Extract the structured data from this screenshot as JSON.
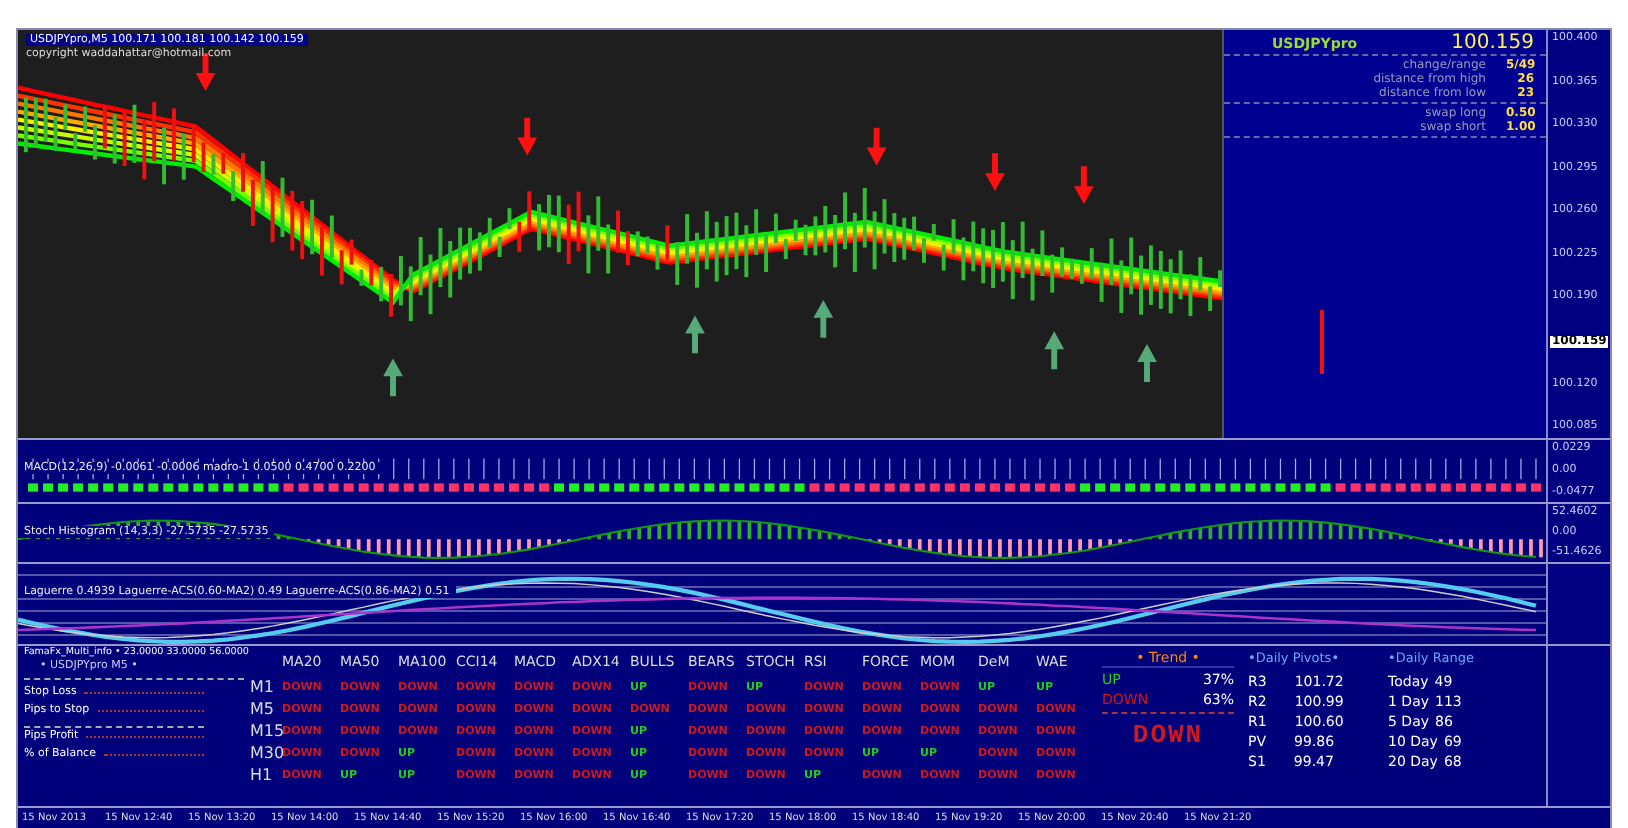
{
  "header": {
    "symbol_line": "USDJPYpro,M5  100.171 100.181 100.142 100.159",
    "copyright": "copyright waddahattar@hotmail.com"
  },
  "info_panel": {
    "symbol": "USDJPYpro",
    "price": "100.159",
    "rows": [
      {
        "label": "change/range",
        "value": "5/49"
      },
      {
        "label": "distance from high",
        "value": "26"
      },
      {
        "label": "distance from low",
        "value": "23"
      }
    ],
    "swap_rows": [
      {
        "label": "swap long",
        "value": "0.50"
      },
      {
        "label": "swap short",
        "value": "1.00"
      }
    ]
  },
  "price_axis": [
    {
      "label": "100.400",
      "current": false
    },
    {
      "label": "100.365",
      "current": false
    },
    {
      "label": "100.330",
      "current": false
    },
    {
      "label": "100.295",
      "current": false
    },
    {
      "label": "100.260",
      "current": false
    },
    {
      "label": "100.225",
      "current": false
    },
    {
      "label": "100.190",
      "current": false
    },
    {
      "label": "100.159",
      "current": true
    },
    {
      "label": "100.120",
      "current": false
    },
    {
      "label": "100.085",
      "current": false
    }
  ],
  "macd": {
    "legend": "MACD(12,26,9) -0.0061 -0.0006  madro-1 0.0500 0.4700 0.2200",
    "axis": [
      "0.0229",
      "0.00",
      "-0.0477"
    ]
  },
  "stoch": {
    "legend": "Stoch Histogram (14,3,3) -27.5735 -27.5735",
    "axis": [
      "52.4602",
      "0.00",
      "-51.4626"
    ]
  },
  "laguerre": {
    "legend": "Laguerre 0.4939  Laguerre-ACS(0.60-MA2) 0.49  Laguerre-ACS(0.86-MA2) 0.51"
  },
  "signals": {
    "header": "FamaFx_Multi_info • 23.0000 33.0000 56.0000",
    "symbol": "• USDJPYpro M5 •",
    "fields": [
      "Stop Loss",
      "Pips to Stop",
      "Pips Profit",
      "% of Balance"
    ],
    "columns": [
      "MA20",
      "MA50",
      "MA100",
      "CCI14",
      "MACD",
      "ADX14",
      "BULLS",
      "BEARS",
      "STOCH",
      "RSI",
      "FORCE",
      "MOM",
      "DeM",
      "WAE"
    ],
    "rows": [
      {
        "timeframe": "M1",
        "cells": [
          {
            "text": "DOWN",
            "kind": "down"
          },
          {
            "text": "DOWN",
            "kind": "down"
          },
          {
            "text": "DOWN",
            "kind": "down"
          },
          {
            "text": "DOWN",
            "kind": "down"
          },
          {
            "text": "DOWN",
            "kind": "down"
          },
          {
            "text": "DOWN",
            "kind": "down"
          },
          {
            "text": "UP",
            "kind": "up"
          },
          {
            "text": "DOWN",
            "kind": "down"
          },
          {
            "text": "UP",
            "kind": "up"
          },
          {
            "text": "DOWN",
            "kind": "down"
          },
          {
            "text": "DOWN",
            "kind": "down"
          },
          {
            "text": "DOWN",
            "kind": "down"
          },
          {
            "text": "UP",
            "kind": "up"
          },
          {
            "text": "UP",
            "kind": "up"
          }
        ]
      },
      {
        "timeframe": "M5",
        "cells": [
          {
            "text": "DOWN",
            "kind": "down"
          },
          {
            "text": "DOWN",
            "kind": "down"
          },
          {
            "text": "DOWN",
            "kind": "down"
          },
          {
            "text": "DOWN",
            "kind": "down"
          },
          {
            "text": "DOWN",
            "kind": "down"
          },
          {
            "text": "DOWN",
            "kind": "down"
          },
          {
            "text": "DOWN",
            "kind": "down"
          },
          {
            "text": "DOWN",
            "kind": "down"
          },
          {
            "text": "DOWN",
            "kind": "down"
          },
          {
            "text": "DOWN",
            "kind": "down"
          },
          {
            "text": "DOWN",
            "kind": "down"
          },
          {
            "text": "DOWN",
            "kind": "down"
          },
          {
            "text": "DOWN",
            "kind": "down"
          },
          {
            "text": "DOWN",
            "kind": "down"
          }
        ]
      },
      {
        "timeframe": "M15",
        "cells": [
          {
            "text": "DOWN",
            "kind": "down"
          },
          {
            "text": "DOWN",
            "kind": "down"
          },
          {
            "text": "DOWN",
            "kind": "down"
          },
          {
            "text": "DOWN",
            "kind": "down"
          },
          {
            "text": "DOWN",
            "kind": "down"
          },
          {
            "text": "DOWN",
            "kind": "down"
          },
          {
            "text": "UP",
            "kind": "up"
          },
          {
            "text": "DOWN",
            "kind": "down"
          },
          {
            "text": "DOWN",
            "kind": "down"
          },
          {
            "text": "DOWN",
            "kind": "down"
          },
          {
            "text": "DOWN",
            "kind": "down"
          },
          {
            "text": "DOWN",
            "kind": "down"
          },
          {
            "text": "DOWN",
            "kind": "down"
          },
          {
            "text": "DOWN",
            "kind": "down"
          }
        ]
      },
      {
        "timeframe": "M30",
        "cells": [
          {
            "text": "DOWN",
            "kind": "down"
          },
          {
            "text": "DOWN",
            "kind": "down"
          },
          {
            "text": "UP",
            "kind": "up"
          },
          {
            "text": "DOWN",
            "kind": "down"
          },
          {
            "text": "DOWN",
            "kind": "down"
          },
          {
            "text": "DOWN",
            "kind": "down"
          },
          {
            "text": "UP",
            "kind": "up"
          },
          {
            "text": "DOWN",
            "kind": "down"
          },
          {
            "text": "DOWN",
            "kind": "down"
          },
          {
            "text": "DOWN",
            "kind": "down"
          },
          {
            "text": "UP",
            "kind": "up"
          },
          {
            "text": "UP",
            "kind": "up"
          },
          {
            "text": "DOWN",
            "kind": "down"
          },
          {
            "text": "DOWN",
            "kind": "down"
          }
        ]
      },
      {
        "timeframe": "H1",
        "cells": [
          {
            "text": "DOWN",
            "kind": "down"
          },
          {
            "text": "UP",
            "kind": "up"
          },
          {
            "text": "UP",
            "kind": "up"
          },
          {
            "text": "DOWN",
            "kind": "down"
          },
          {
            "text": "DOWN",
            "kind": "down"
          },
          {
            "text": "DOWN",
            "kind": "down"
          },
          {
            "text": "UP",
            "kind": "up"
          },
          {
            "text": "DOWN",
            "kind": "down"
          },
          {
            "text": "DOWN",
            "kind": "down"
          },
          {
            "text": "UP",
            "kind": "up"
          },
          {
            "text": "DOWN",
            "kind": "down"
          },
          {
            "text": "DOWN",
            "kind": "down"
          },
          {
            "text": "DOWN",
            "kind": "down"
          },
          {
            "text": "DOWN",
            "kind": "down"
          }
        ]
      }
    ]
  },
  "trend": {
    "title": "• Trend •",
    "rows": [
      {
        "label": "UP",
        "value": "37%",
        "kind": "up"
      },
      {
        "label": "DOWN",
        "value": "63%",
        "kind": "down"
      }
    ],
    "verdict": {
      "text": "DOWN",
      "kind": "down"
    }
  },
  "pivots": {
    "title": "•Daily Pivots•",
    "rows": [
      {
        "label": "R3",
        "value": "101.72"
      },
      {
        "label": "R2",
        "value": "100.99"
      },
      {
        "label": "R1",
        "value": "100.60"
      },
      {
        "label": "PV",
        "value": "99.86"
      },
      {
        "label": "S1",
        "value": "99.47"
      }
    ]
  },
  "range": {
    "title": "•Daily Range",
    "rows": [
      {
        "label": "Today",
        "value": "49"
      },
      {
        "label": "1 Day",
        "value": "113"
      },
      {
        "label": "5 Day",
        "value": "86"
      },
      {
        "label": "10 Day",
        "value": "69"
      },
      {
        "label": "20 Day",
        "value": "68"
      }
    ]
  },
  "time_axis": [
    "15 Nov 2013",
    "15 Nov 12:40",
    "15 Nov 13:20",
    "15 Nov 14:00",
    "15 Nov 14:40",
    "15 Nov 15:20",
    "15 Nov 16:00",
    "15 Nov 16:40",
    "15 Nov 17:20",
    "15 Nov 18:00",
    "15 Nov 18:40",
    "15 Nov 19:20",
    "15 Nov 20:00",
    "15 Nov 20:40",
    "15 Nov 21:20"
  ]
}
